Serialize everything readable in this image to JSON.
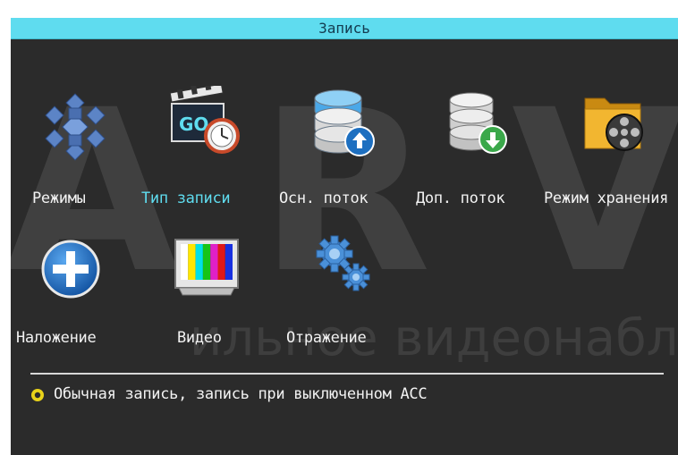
{
  "window": {
    "title": "Запись"
  },
  "watermark": {
    "big": "ARVI",
    "small": "ильное видеонаблюд"
  },
  "menu": {
    "items": [
      {
        "label": "Режимы",
        "icon": "snowflake-cubes-icon"
      },
      {
        "label": "Тип записи",
        "icon": "clapperboard-clock-icon",
        "icon_text": "GO"
      },
      {
        "label": "Осн. поток",
        "icon": "database-upload-icon"
      },
      {
        "label": "Доп. поток",
        "icon": "database-download-icon"
      },
      {
        "label": "Режим хранения",
        "icon": "folder-film-reel-icon"
      },
      {
        "label": "Наложение",
        "icon": "plus-circle-icon"
      },
      {
        "label": "Видео",
        "icon": "tv-color-bars-icon"
      },
      {
        "label": "Отражение",
        "icon": "gears-icon"
      }
    ],
    "selected_index": 1
  },
  "status": {
    "text": "Обычная запись, запись при выключенном ACC",
    "icon": "radio-dot-icon"
  },
  "colors": {
    "accent": "#5fdcef",
    "background": "#2b2b2b",
    "text": "#f2f2f2"
  }
}
